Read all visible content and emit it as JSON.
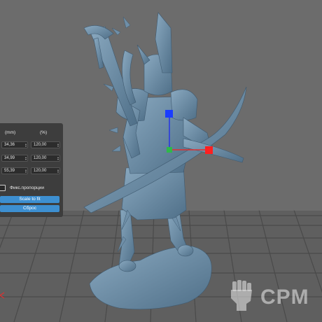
{
  "scale_panel": {
    "unit_mm": "(mm)",
    "unit_pct": "(%)",
    "rows": [
      {
        "mm": "34,36",
        "pct": "120,00"
      },
      {
        "mm": "34,99",
        "pct": "120,00"
      },
      {
        "mm": "55,39",
        "pct": "120,00"
      }
    ],
    "proportional_label": "Фикс.пропорции",
    "proportional_checked": false,
    "scale_to_fit_label": "Scale to fit",
    "reset_label": "Сброс"
  },
  "gizmo": {
    "x_axis_color": "#e03030",
    "y_axis_color": "#2fb84a",
    "z_axis_color": "#2a3ae0"
  },
  "watermark": {
    "text": "CPM",
    "icon": "raised-fist-icon"
  },
  "colors": {
    "viewport_bg": "#6c6c6c",
    "floor_grid": "#4c4c4c",
    "model": "#6f8fa8",
    "panel_bg": "#3d3d3d",
    "button_blue": "#3d8fd1"
  }
}
